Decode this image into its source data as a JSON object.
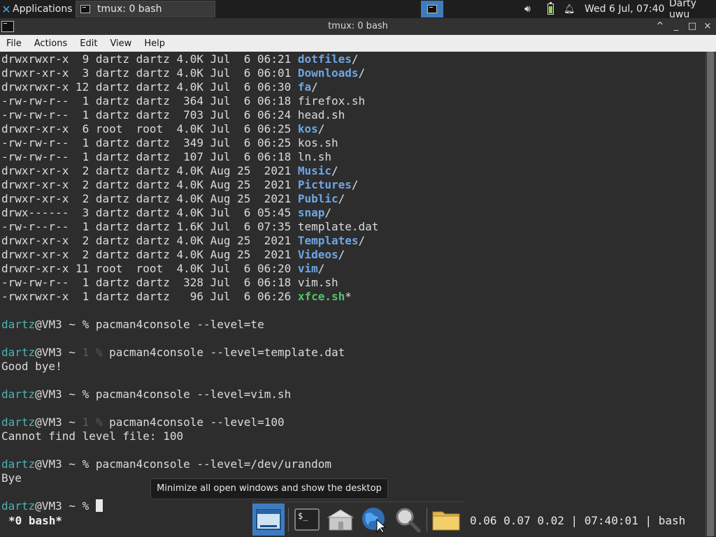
{
  "top_panel": {
    "applications_label": "Applications",
    "task_label": "tmux: 0 bash",
    "clock": "Wed  6 Jul, 07:40",
    "user": "Darty uwu",
    "tray_icons": [
      "volume-icon",
      "battery-icon",
      "notification-bell-icon"
    ]
  },
  "window": {
    "title": "tmux: 0 bash",
    "controls": [
      "^",
      "_",
      "□",
      "×"
    ]
  },
  "menu": [
    "File",
    "Actions",
    "Edit",
    "View",
    "Help"
  ],
  "listing": [
    {
      "perm": "drwxrwxr-x  9 dartz dartz 4.0K Jul  6 06:21 ",
      "name": "dotfiles",
      "type": "dir"
    },
    {
      "perm": "drwxr-xr-x  3 dartz dartz 4.0K Jul  6 06:01 ",
      "name": "Downloads",
      "type": "dir"
    },
    {
      "perm": "drwxrwxr-x 12 dartz dartz 4.0K Jul  6 06:30 ",
      "name": "fa",
      "type": "dir"
    },
    {
      "perm": "-rw-rw-r--  1 dartz dartz  364 Jul  6 06:18 ",
      "name": "firefox.sh",
      "type": "file"
    },
    {
      "perm": "-rw-rw-r--  1 dartz dartz  703 Jul  6 06:24 ",
      "name": "head.sh",
      "type": "file"
    },
    {
      "perm": "drwxr-xr-x  6 root  root  4.0K Jul  6 06:25 ",
      "name": "kos",
      "type": "dir"
    },
    {
      "perm": "-rw-rw-r--  1 dartz dartz  349 Jul  6 06:25 ",
      "name": "kos.sh",
      "type": "file"
    },
    {
      "perm": "-rw-rw-r--  1 dartz dartz  107 Jul  6 06:18 ",
      "name": "ln.sh",
      "type": "file"
    },
    {
      "perm": "drwxr-xr-x  2 dartz dartz 4.0K Aug 25  2021 ",
      "name": "Music",
      "type": "dir"
    },
    {
      "perm": "drwxr-xr-x  2 dartz dartz 4.0K Aug 25  2021 ",
      "name": "Pictures",
      "type": "dir"
    },
    {
      "perm": "drwxr-xr-x  2 dartz dartz 4.0K Aug 25  2021 ",
      "name": "Public",
      "type": "dir"
    },
    {
      "perm": "drwx------  3 dartz dartz 4.0K Jul  6 05:45 ",
      "name": "snap",
      "type": "dir"
    },
    {
      "perm": "-rw-r--r--  1 dartz dartz 1.6K Jul  6 07:35 ",
      "name": "template.dat",
      "type": "file"
    },
    {
      "perm": "drwxr-xr-x  2 dartz dartz 4.0K Aug 25  2021 ",
      "name": "Templates",
      "type": "dir"
    },
    {
      "perm": "drwxr-xr-x  2 dartz dartz 4.0K Aug 25  2021 ",
      "name": "Videos",
      "type": "dir"
    },
    {
      "perm": "drwxr-xr-x 11 root  root  4.0K Jul  6 06:20 ",
      "name": "vim",
      "type": "dir"
    },
    {
      "perm": "-rw-rw-r--  1 dartz dartz  328 Jul  6 06:18 ",
      "name": "vim.sh",
      "type": "file"
    },
    {
      "perm": "-rwxrwxr-x  1 dartz dartz   96 Jul  6 06:26 ",
      "name": "xfce.sh",
      "type": "exe"
    }
  ],
  "session": [
    {
      "user": "dartz",
      "host": "@VM3 ~ ",
      "code": "",
      "cmd": "% pacman4console --level=te",
      "output": ""
    },
    {
      "user": "dartz",
      "host": "@VM3 ~ ",
      "code": "1 % ",
      "cmd": "pacman4console --level=template.dat",
      "output": "Good bye!"
    },
    {
      "user": "dartz",
      "host": "@VM3 ~ ",
      "code": "",
      "cmd": "% pacman4console --level=vim.sh",
      "output": ""
    },
    {
      "user": "dartz",
      "host": "@VM3 ~ ",
      "code": "1 % ",
      "cmd": "pacman4console --level=100",
      "output": "Cannot find level file: 100"
    },
    {
      "user": "dartz",
      "host": "@VM3 ~ ",
      "code": "",
      "cmd": "% pacman4console --level=/dev/urandom",
      "output": "Bye"
    }
  ],
  "prompt": {
    "user": "dartz",
    "host": "@VM3 ~ ",
    "symbol": "% "
  },
  "tmux_status": {
    "left": "*0 bash*",
    "right": "0.06 0.07 0.02 | 07:40:01 | bash"
  },
  "tooltip": "Minimize all open windows and show the desktop",
  "dock": [
    "show-desktop-icon",
    "terminal-icon",
    "home-folder-icon",
    "web-browser-icon",
    "app-finder-icon",
    "file-manager-icon"
  ]
}
